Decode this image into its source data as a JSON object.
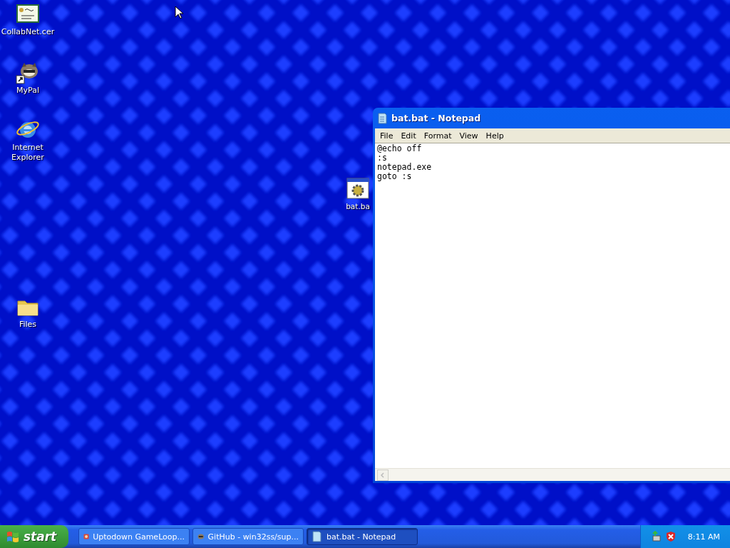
{
  "desktop_icons": [
    {
      "kind": "certificate",
      "label": "CollabNet.cer",
      "shortcut": false
    },
    {
      "kind": "raccoon",
      "label": "MyPal",
      "shortcut": true
    },
    {
      "kind": "browser",
      "label": "Internet Explorer",
      "shortcut": false
    },
    {
      "kind": "batch",
      "label": "bat.ba",
      "shortcut": false
    },
    {
      "kind": "folder",
      "label": "Files",
      "shortcut": false
    }
  ],
  "window": {
    "title": "bat.bat - Notepad",
    "menu": [
      "File",
      "Edit",
      "Format",
      "View",
      "Help"
    ],
    "lines": [
      "@echo off",
      ":s",
      "notepad.exe",
      "goto :s"
    ]
  },
  "taskbar": {
    "start": "start",
    "buttons": [
      {
        "kind": "game",
        "label": "Uptodown GameLoop...",
        "selected": false
      },
      {
        "kind": "raccoon",
        "label": "GitHub - win32ss/sup...",
        "selected": false
      },
      {
        "kind": "notepad",
        "label": "bat.bat - Notepad",
        "selected": true
      }
    ],
    "tray": [
      {
        "kind": "network"
      },
      {
        "kind": "shield"
      }
    ],
    "clock": "8:11 AM"
  }
}
